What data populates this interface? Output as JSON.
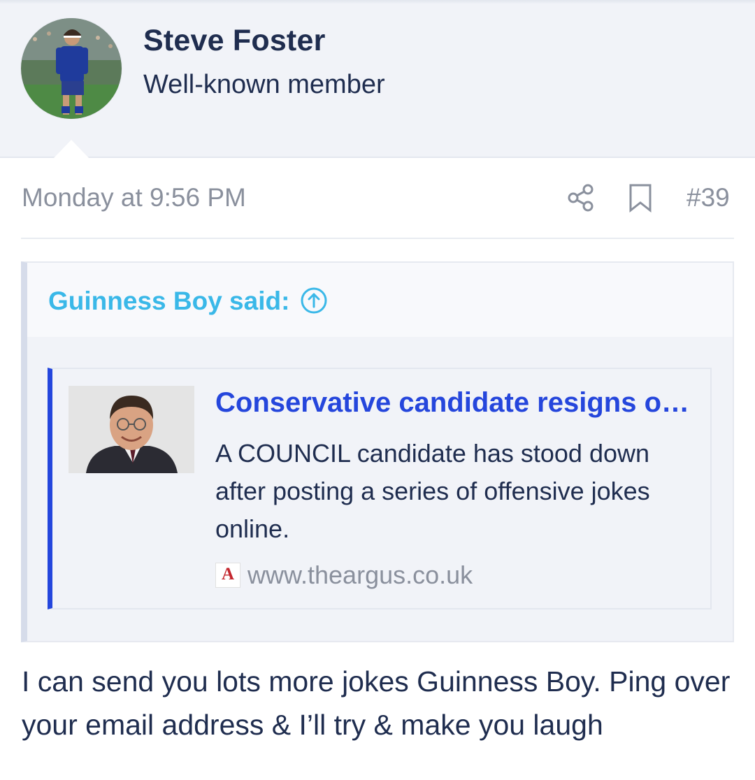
{
  "author": {
    "name": "Steve Foster",
    "title": "Well-known member",
    "avatar_icon": "user-avatar-photo"
  },
  "message": {
    "date": "Monday at 9:56 PM",
    "post_number": "#39",
    "share_icon": "share-icon",
    "bookmark_icon": "bookmark-icon"
  },
  "quote": {
    "author_label": "Guinness Boy said:",
    "jump_icon": "arrow-up-circle-icon",
    "link_card": {
      "title": "Conservative candidate resigns over offensive jokes",
      "description": "A COUNCIL candidate has stood down after posting a series of offensive jokes online.",
      "domain": "www.theargus.co.uk",
      "favicon_letter": "A",
      "accent_color": "#2446dd"
    }
  },
  "body": {
    "text": "I can send you lots more jokes Guinness Boy. Ping over your email address & I’ll try & make you laugh"
  },
  "colors": {
    "header_bg": "#f1f3f8",
    "name": "#1f2d4f",
    "meta": "#8a909d",
    "quote_author": "#3ab8e8",
    "link_title": "#2546dc"
  }
}
